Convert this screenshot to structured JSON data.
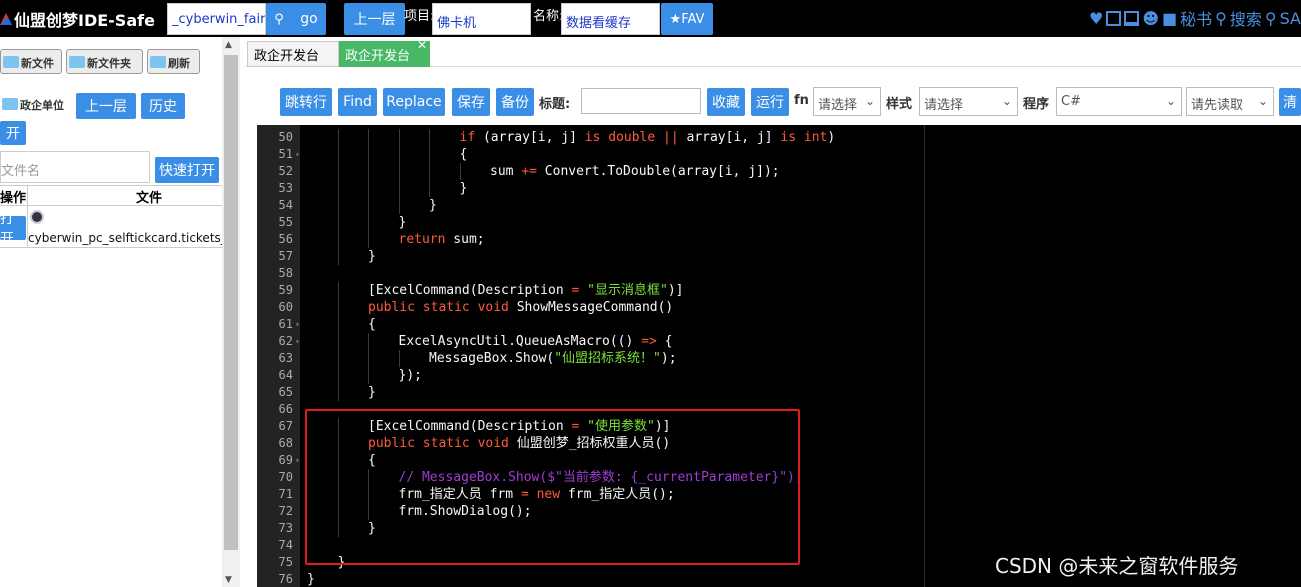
{
  "app": {
    "title": "仙盟创梦IDE-Safe"
  },
  "topbar": {
    "search_value": "_cyberwin_fairya",
    "go_label": "go",
    "up_label": "上一层",
    "project_label": "项目:",
    "project_value": "佛卡机",
    "name_label": "名称:",
    "name_value": "数据看缓存",
    "fav_label": "★FAV",
    "right_items": [
      "♥",
      "秘书",
      "搜索",
      "SA"
    ]
  },
  "sidebar": {
    "new_file": "新文件",
    "new_folder": "新文件夹",
    "refresh": "刷新",
    "gov_unit": "政企单位",
    "up_level": "上一层",
    "history": "历史",
    "open": "开",
    "file_placeholder": "文件名",
    "quick_open": "快速打开",
    "col_action": "操作",
    "col_file": "文件",
    "row_open": "打开",
    "file_name": "cyberwin_pc_selftickcard.tickets_or"
  },
  "tabs": [
    {
      "label": "政企开发台",
      "active": false
    },
    {
      "label": "政企开发台",
      "active": true
    }
  ],
  "toolbar": {
    "goto": "跳转行",
    "find": "Find",
    "replace": "Replace",
    "save": "保存",
    "backup": "备份",
    "title_label": "标题:",
    "title_value": "",
    "collect": "收藏",
    "run": "运行",
    "fn_label": "fn",
    "fn_select": "请选择",
    "style_label": "样式",
    "style_select": "请选择",
    "program_label": "程序",
    "program_select": "C#",
    "read_select": "请先读取",
    "clear_partial": "清"
  },
  "editor": {
    "lines": [
      {
        "n": "50",
        "fold": false,
        "indent": 5,
        "segs": [
          [
            "k",
            "if"
          ],
          [
            "t",
            " (array[i, j] "
          ],
          [
            "k",
            "is"
          ],
          [
            "t",
            " "
          ],
          [
            "k",
            "double"
          ],
          [
            "t",
            " "
          ],
          [
            "k",
            "||"
          ],
          [
            "t",
            " array[i, j] "
          ],
          [
            "k",
            "is"
          ],
          [
            "t",
            " "
          ],
          [
            "k",
            "int"
          ],
          [
            "t",
            ")"
          ]
        ]
      },
      {
        "n": "51",
        "fold": true,
        "indent": 5,
        "segs": [
          [
            "t",
            "{"
          ]
        ]
      },
      {
        "n": "52",
        "fold": false,
        "indent": 6,
        "segs": [
          [
            "t",
            "sum "
          ],
          [
            "k",
            "+="
          ],
          [
            "t",
            " Convert.ToDouble(array[i, j]);"
          ]
        ]
      },
      {
        "n": "53",
        "fold": false,
        "indent": 5,
        "segs": [
          [
            "t",
            "}"
          ]
        ]
      },
      {
        "n": "54",
        "fold": false,
        "indent": 4,
        "segs": [
          [
            "t",
            "}"
          ]
        ]
      },
      {
        "n": "55",
        "fold": false,
        "indent": 3,
        "segs": [
          [
            "t",
            "}"
          ]
        ]
      },
      {
        "n": "56",
        "fold": false,
        "indent": 3,
        "segs": [
          [
            "k",
            "return"
          ],
          [
            "t",
            " sum;"
          ]
        ]
      },
      {
        "n": "57",
        "fold": false,
        "indent": 2,
        "segs": [
          [
            "t",
            "}"
          ]
        ]
      },
      {
        "n": "58",
        "fold": false,
        "indent": 0,
        "segs": []
      },
      {
        "n": "59",
        "fold": false,
        "indent": 2,
        "segs": [
          [
            "t",
            "[ExcelCommand(Description "
          ],
          [
            "k",
            "="
          ],
          [
            "t",
            " "
          ],
          [
            "s",
            "\"显示消息框\""
          ],
          [
            "t",
            ")]"
          ]
        ]
      },
      {
        "n": "60",
        "fold": false,
        "indent": 2,
        "segs": [
          [
            "k",
            "public static void"
          ],
          [
            "t",
            " ShowMessageCommand()"
          ]
        ]
      },
      {
        "n": "61",
        "fold": true,
        "indent": 2,
        "segs": [
          [
            "t",
            "{"
          ]
        ]
      },
      {
        "n": "62",
        "fold": true,
        "indent": 3,
        "segs": [
          [
            "t",
            "ExcelAsyncUtil.QueueAsMacro(() "
          ],
          [
            "k",
            "=>"
          ],
          [
            "t",
            " {"
          ]
        ]
      },
      {
        "n": "63",
        "fold": false,
        "indent": 4,
        "segs": [
          [
            "t",
            "MessageBox.Show("
          ],
          [
            "s",
            "\"仙盟招标系统！\""
          ],
          [
            "t",
            ");"
          ]
        ]
      },
      {
        "n": "64",
        "fold": false,
        "indent": 3,
        "segs": [
          [
            "t",
            "});"
          ]
        ]
      },
      {
        "n": "65",
        "fold": false,
        "indent": 2,
        "segs": [
          [
            "t",
            "}"
          ]
        ]
      },
      {
        "n": "66",
        "fold": false,
        "indent": 0,
        "segs": []
      },
      {
        "n": "67",
        "fold": false,
        "indent": 2,
        "segs": [
          [
            "t",
            "[ExcelCommand(Description "
          ],
          [
            "k",
            "="
          ],
          [
            "t",
            " "
          ],
          [
            "s",
            "\"使用参数\""
          ],
          [
            "t",
            ")]"
          ]
        ]
      },
      {
        "n": "68",
        "fold": false,
        "indent": 2,
        "segs": [
          [
            "k",
            "public static void"
          ],
          [
            "t",
            " 仙盟创梦_招标权重人员()"
          ]
        ]
      },
      {
        "n": "69",
        "fold": true,
        "indent": 2,
        "segs": [
          [
            "t",
            "{"
          ]
        ]
      },
      {
        "n": "70",
        "fold": false,
        "indent": 3,
        "segs": [
          [
            "c",
            "// MessageBox.Show($\"当前参数: {_currentParameter}\");"
          ]
        ]
      },
      {
        "n": "71",
        "fold": false,
        "indent": 3,
        "segs": [
          [
            "t",
            "frm_指定人员 frm "
          ],
          [
            "k",
            "="
          ],
          [
            "t",
            " "
          ],
          [
            "k",
            "new"
          ],
          [
            "t",
            " frm_指定人员();"
          ]
        ]
      },
      {
        "n": "72",
        "fold": false,
        "indent": 3,
        "segs": [
          [
            "t",
            "frm.ShowDialog();"
          ]
        ]
      },
      {
        "n": "73",
        "fold": false,
        "indent": 2,
        "segs": [
          [
            "t",
            "}"
          ]
        ]
      },
      {
        "n": "74",
        "fold": false,
        "indent": 0,
        "segs": []
      },
      {
        "n": "75",
        "fold": false,
        "indent": 1,
        "segs": [
          [
            "t",
            "}"
          ]
        ]
      },
      {
        "n": "76",
        "fold": false,
        "indent": 0,
        "segs": [
          [
            "t",
            "}"
          ]
        ]
      }
    ]
  },
  "watermark": "CSDN @未来之窗软件服务",
  "colors": {
    "accent": "#3a8ee6",
    "keyword": "#ff5a3c",
    "string": "#7ee03c",
    "comment": "#a03cd4",
    "highlight_box": "#e01b1b"
  }
}
